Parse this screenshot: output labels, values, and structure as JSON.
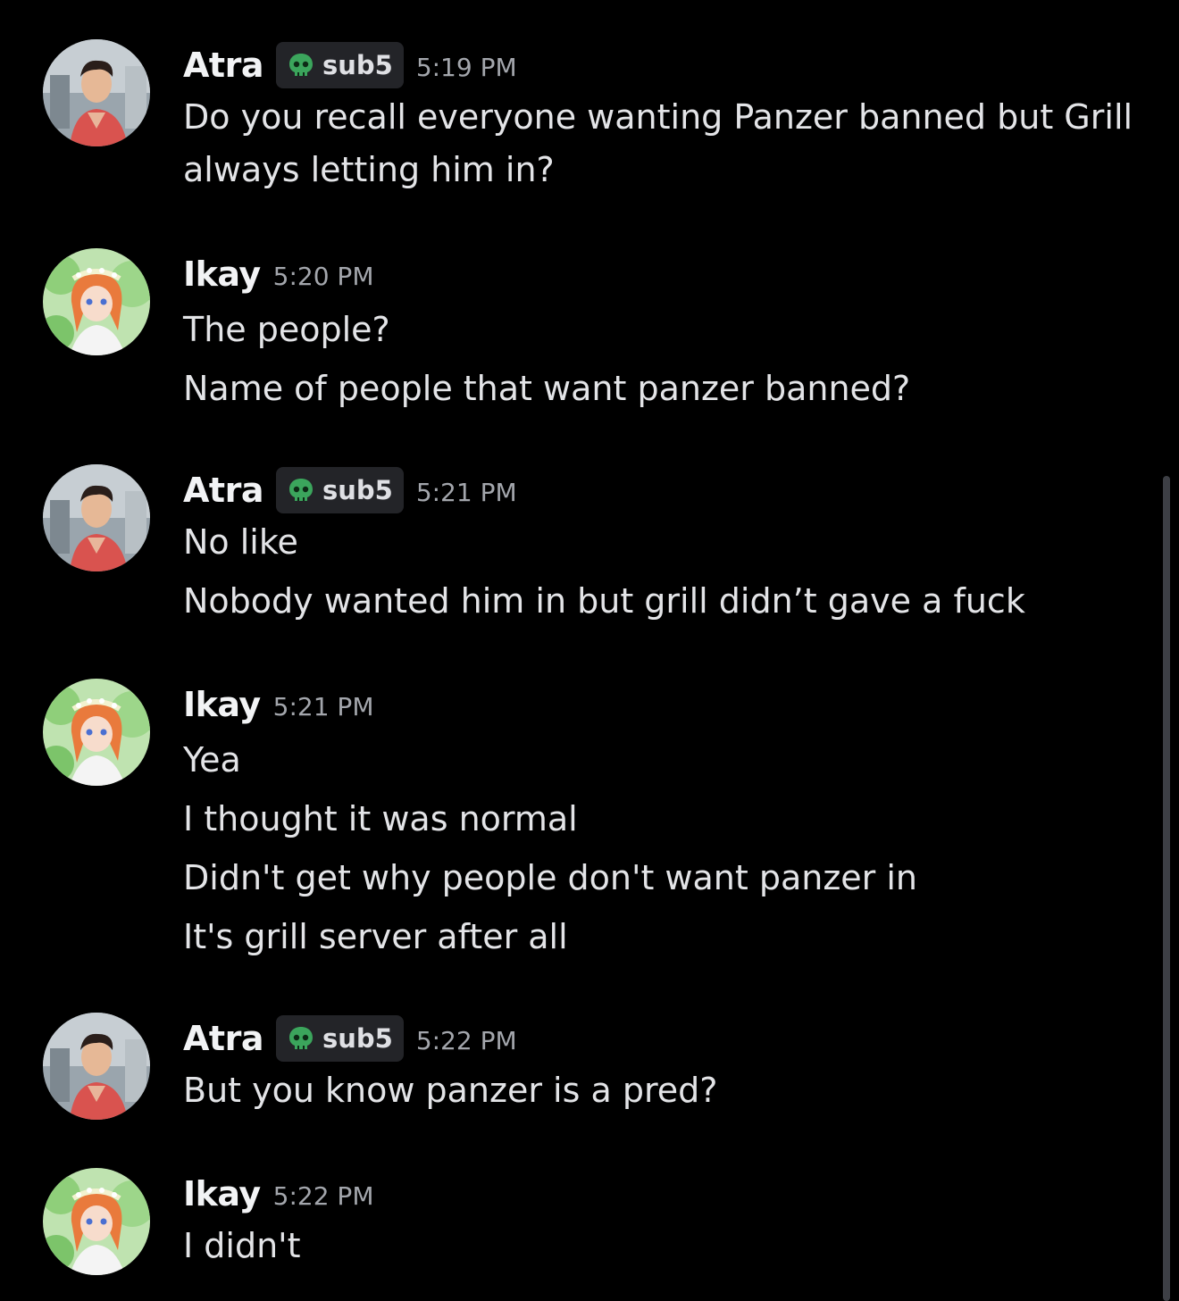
{
  "messages": [
    {
      "author": "Atra",
      "avatar": "atra-avatar",
      "tag": {
        "icon": "skull-icon",
        "label": "sub5"
      },
      "time": "5:19 PM",
      "lines": [
        "Do you recall everyone wanting Panzer banned but Grill",
        "always letting him in?"
      ]
    },
    {
      "author": "Ikay",
      "avatar": "ikay-avatar",
      "time": "5:20 PM",
      "lines": [
        "The people?",
        "Name of people that want panzer banned?"
      ]
    },
    {
      "author": "Atra",
      "avatar": "atra-avatar",
      "tag": {
        "icon": "skull-icon",
        "label": "sub5"
      },
      "time": "5:21 PM",
      "lines": [
        "No like",
        "Nobody wanted him in but grill didn’t gave a fuck"
      ]
    },
    {
      "author": "Ikay",
      "avatar": "ikay-avatar",
      "time": "5:21 PM",
      "lines": [
        "Yea",
        "I thought it was normal",
        "Didn't get why people don't want panzer in",
        "It's grill server after all"
      ]
    },
    {
      "author": "Atra",
      "avatar": "atra-avatar",
      "tag": {
        "icon": "skull-icon",
        "label": "sub5"
      },
      "time": "5:22 PM",
      "lines": [
        "But you know panzer is a pred?"
      ]
    },
    {
      "author": "Ikay",
      "avatar": "ikay-avatar",
      "time": "5:22 PM",
      "lines": [
        "I didn't"
      ]
    }
  ],
  "colors": {
    "background": "#000000",
    "username": "#f2f3f5",
    "message_text": "#e3e4e7",
    "timestamp": "#a3a6ac",
    "tag_background": "#232428",
    "skull_green": "#3ba55c"
  }
}
